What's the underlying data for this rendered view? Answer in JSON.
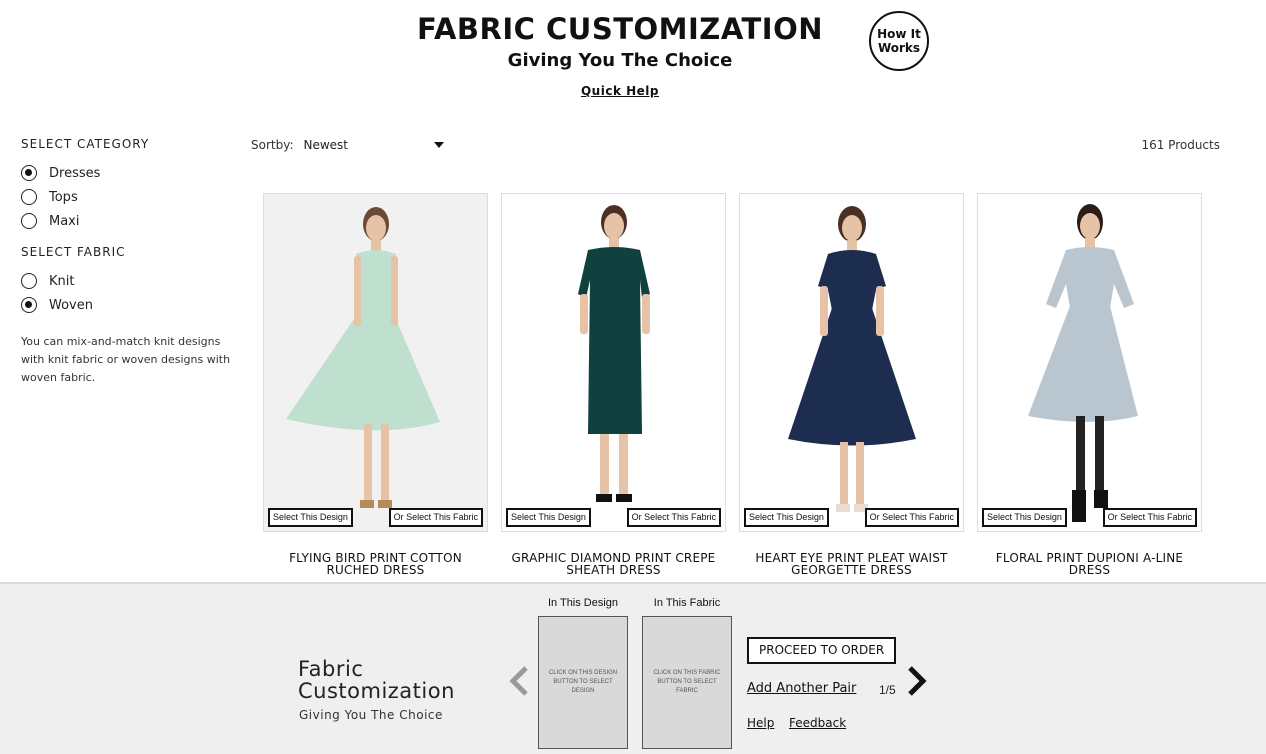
{
  "header": {
    "title": "FABRIC CUSTOMIZATION",
    "subtitle": "Giving You The Choice",
    "quick_help": "Quick Help",
    "how_it_works_line1": "How It",
    "how_it_works_line2": "Works"
  },
  "sidebar": {
    "category_heading": "SELECT CATEGORY",
    "categories": [
      {
        "label": "Dresses",
        "checked": true
      },
      {
        "label": "Tops",
        "checked": false
      },
      {
        "label": "Maxi",
        "checked": false
      }
    ],
    "fabric_heading": "SELECT FABRIC",
    "fabrics": [
      {
        "label": "Knit",
        "checked": false
      },
      {
        "label": "Woven",
        "checked": true
      }
    ],
    "note": "You can mix-and-match knit designs with knit fabric or woven designs with woven fabric."
  },
  "toolbar": {
    "sort_label": "Sortby:",
    "sort_value": "Newest",
    "product_count": "161 Products"
  },
  "products": [
    {
      "name_line1": "FLYING BIRD PRINT COTTON",
      "name_line2": "RUCHED DRESS",
      "select_design": "Select This Design",
      "select_fabric": "Or Select This Fabric",
      "dress_color": "#bfe0cf"
    },
    {
      "name_line1": "GRAPHIC DIAMOND PRINT CREPE",
      "name_line2": "SHEATH DRESS",
      "select_design": "Select This Design",
      "select_fabric": "Or Select This Fabric",
      "dress_color": "#10413f"
    },
    {
      "name_line1": "HEART EYE PRINT PLEAT WAIST",
      "name_line2": "GEORGETTE DRESS",
      "select_design": "Select This Design",
      "select_fabric": "Or Select This Fabric",
      "dress_color": "#1c2d4f"
    },
    {
      "name_line1": "FLORAL PRINT DUPIONI A-LINE",
      "name_line2": "DRESS",
      "select_design": "Select This Design",
      "select_fabric": "Or Select This Fabric",
      "dress_color": "#b9c6cf"
    }
  ],
  "bottom_bar": {
    "title_line1": "Fabric",
    "title_line2": "Customization",
    "subtitle": "Giving You The Choice",
    "design_label": "In This Design",
    "fabric_label": "In This Fabric",
    "design_slot_text": "CLICK ON THIS DESIGN BUTTON TO SELECT DESIGN",
    "fabric_slot_text": "CLICK ON THIS FABRIC BUTTON TO SELECT FABRIC",
    "proceed": "PROCEED TO ORDER",
    "add_pair": "Add Another Pair",
    "page_indicator": "1/5",
    "help": "Help",
    "feedback": "Feedback"
  }
}
